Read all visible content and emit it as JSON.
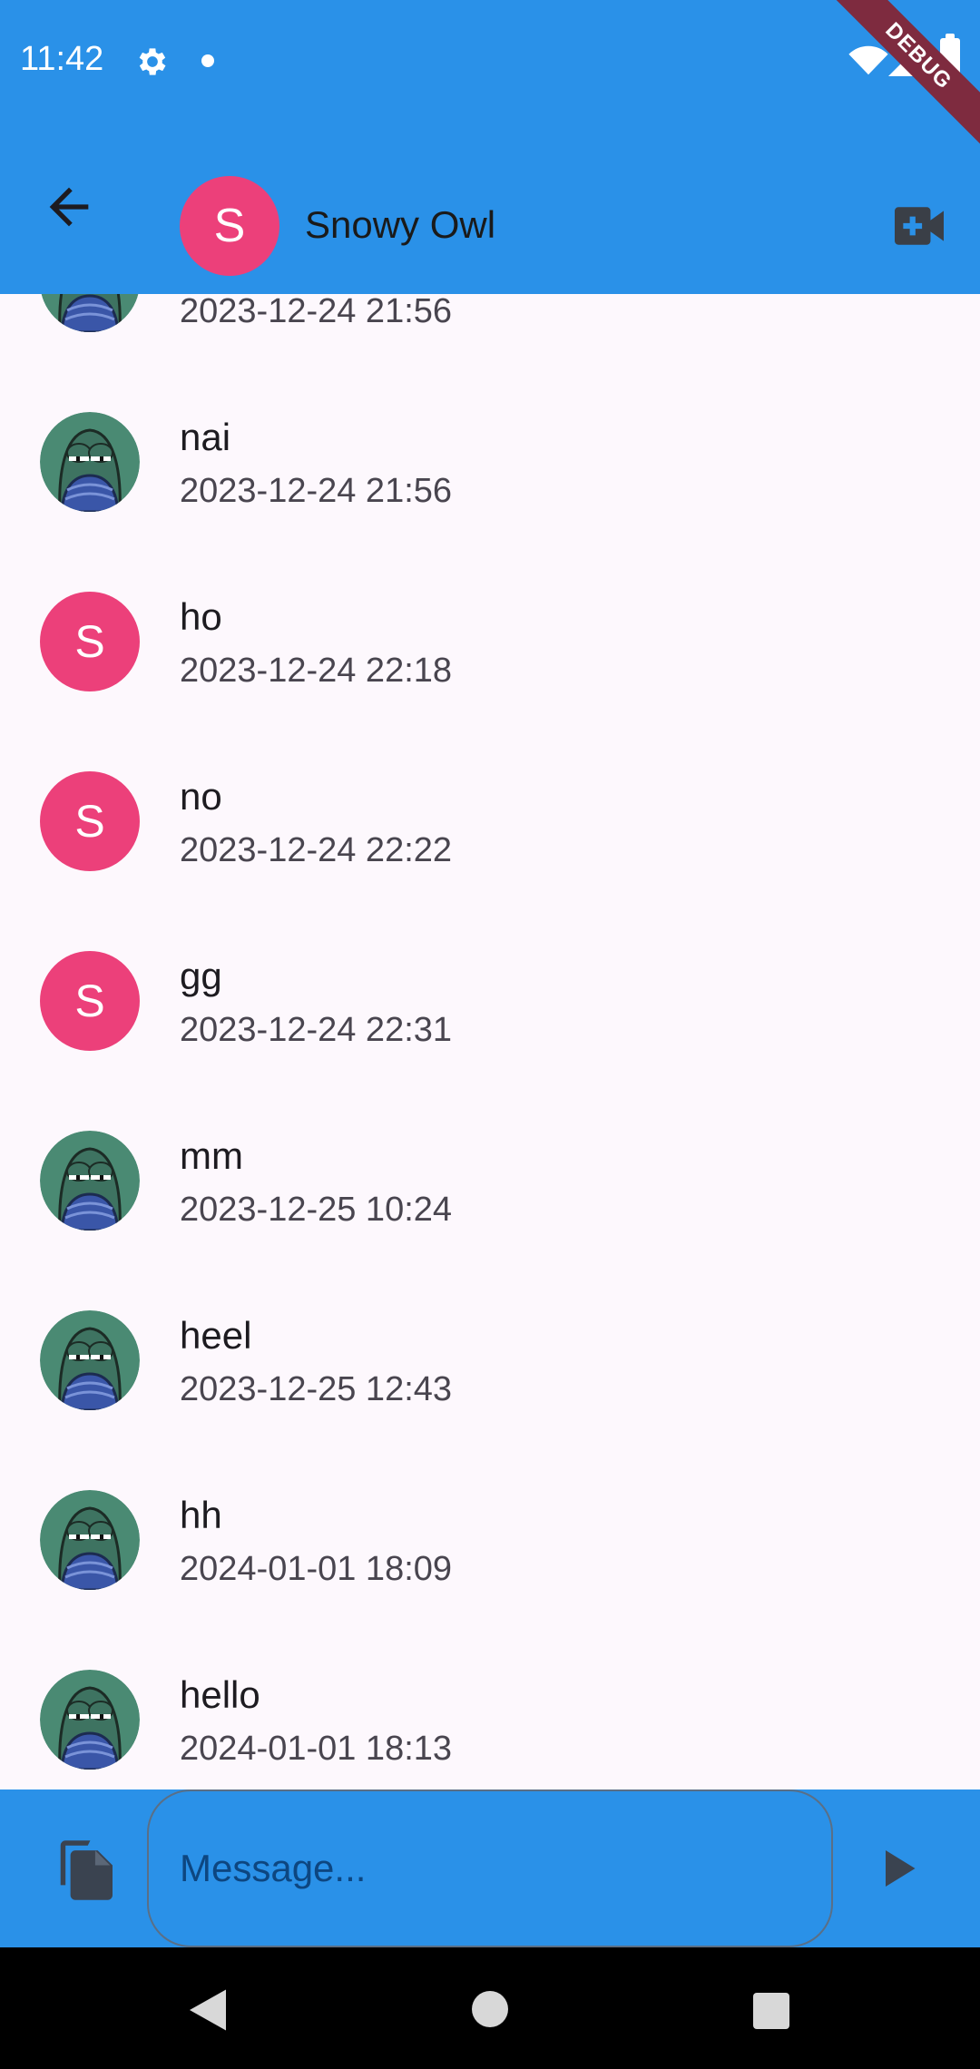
{
  "status_bar": {
    "time": "11:42",
    "icons": [
      "gear-icon",
      "notification-dot",
      "wifi-icon",
      "signal-icon",
      "battery-icon"
    ]
  },
  "debug_banner": "DEBUG",
  "header": {
    "avatar_letter": "S",
    "name": "Snowy Owl",
    "icons": [
      "arrow-back-icon",
      "video-call-icon"
    ]
  },
  "messages": [
    {
      "text": "",
      "time": "2023-12-24 21:56",
      "avatar": "fish"
    },
    {
      "text": "nai",
      "time": "2023-12-24 21:56",
      "avatar": "fish"
    },
    {
      "text": "ho",
      "time": "2023-12-24 22:18",
      "avatar": "S"
    },
    {
      "text": "no",
      "time": "2023-12-24 22:22",
      "avatar": "S"
    },
    {
      "text": "gg",
      "time": "2023-12-24 22:31",
      "avatar": "S"
    },
    {
      "text": "mm",
      "time": "2023-12-25 10:24",
      "avatar": "fish"
    },
    {
      "text": "heel",
      "time": "2023-12-25 12:43",
      "avatar": "fish"
    },
    {
      "text": "hh",
      "time": "2024-01-01 18:09",
      "avatar": "fish"
    },
    {
      "text": "hello",
      "time": "2024-01-01 18:13",
      "avatar": "fish"
    }
  ],
  "composer": {
    "placeholder": "Message...",
    "value": "",
    "icons": [
      "attach-file-icon",
      "send-icon"
    ]
  },
  "colors": {
    "app_bar": "#2a91e8",
    "avatar_pink": "#ec407a",
    "background": "#fdf8fd",
    "debug_banner": "#7e2b3f"
  }
}
